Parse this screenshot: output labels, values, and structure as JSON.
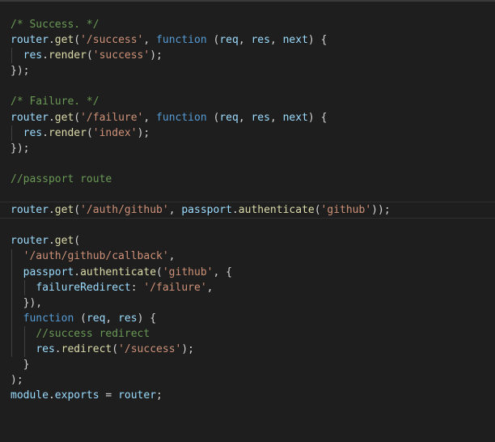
{
  "editor": {
    "theme": {
      "background": "#1e1e1e",
      "comment": "#6a9955",
      "variable": "#9cdcfe",
      "function": "#dcdcaa",
      "string": "#ce9178",
      "keyword": "#569cd6",
      "punctuation": "#d4d4d4"
    },
    "lines": [
      [
        {
          "t": "comment",
          "v": "/* Success. */"
        }
      ],
      [
        {
          "t": "variable",
          "v": "router"
        },
        {
          "t": "punct",
          "v": "."
        },
        {
          "t": "function",
          "v": "get"
        },
        {
          "t": "punct",
          "v": "("
        },
        {
          "t": "string",
          "v": "'/success'"
        },
        {
          "t": "punct",
          "v": ", "
        },
        {
          "t": "keyword",
          "v": "function"
        },
        {
          "t": "punct",
          "v": " ("
        },
        {
          "t": "variable",
          "v": "req"
        },
        {
          "t": "punct",
          "v": ", "
        },
        {
          "t": "variable",
          "v": "res"
        },
        {
          "t": "punct",
          "v": ", "
        },
        {
          "t": "variable",
          "v": "next"
        },
        {
          "t": "punct",
          "v": ") {"
        }
      ],
      [
        {
          "t": "punct",
          "v": "  "
        },
        {
          "t": "variable",
          "v": "res"
        },
        {
          "t": "punct",
          "v": "."
        },
        {
          "t": "function",
          "v": "render"
        },
        {
          "t": "punct",
          "v": "("
        },
        {
          "t": "string",
          "v": "'success'"
        },
        {
          "t": "punct",
          "v": ");"
        }
      ],
      [
        {
          "t": "punct",
          "v": "});"
        }
      ],
      [],
      [
        {
          "t": "comment",
          "v": "/* Failure. */"
        }
      ],
      [
        {
          "t": "variable",
          "v": "router"
        },
        {
          "t": "punct",
          "v": "."
        },
        {
          "t": "function",
          "v": "get"
        },
        {
          "t": "punct",
          "v": "("
        },
        {
          "t": "string",
          "v": "'/failure'"
        },
        {
          "t": "punct",
          "v": ", "
        },
        {
          "t": "keyword",
          "v": "function"
        },
        {
          "t": "punct",
          "v": " ("
        },
        {
          "t": "variable",
          "v": "req"
        },
        {
          "t": "punct",
          "v": ", "
        },
        {
          "t": "variable",
          "v": "res"
        },
        {
          "t": "punct",
          "v": ", "
        },
        {
          "t": "variable",
          "v": "next"
        },
        {
          "t": "punct",
          "v": ") {"
        }
      ],
      [
        {
          "t": "punct",
          "v": "  "
        },
        {
          "t": "variable",
          "v": "res"
        },
        {
          "t": "punct",
          "v": "."
        },
        {
          "t": "function",
          "v": "render"
        },
        {
          "t": "punct",
          "v": "("
        },
        {
          "t": "string",
          "v": "'index'"
        },
        {
          "t": "punct",
          "v": ");"
        }
      ],
      [
        {
          "t": "punct",
          "v": "});"
        }
      ],
      [],
      [
        {
          "t": "comment",
          "v": "//passport route"
        }
      ],
      [],
      [
        {
          "t": "variable",
          "v": "router"
        },
        {
          "t": "punct",
          "v": "."
        },
        {
          "t": "function",
          "v": "get"
        },
        {
          "t": "punct",
          "v": "("
        },
        {
          "t": "string",
          "v": "'/auth/github'"
        },
        {
          "t": "punct",
          "v": ", "
        },
        {
          "t": "variable",
          "v": "passport"
        },
        {
          "t": "punct",
          "v": "."
        },
        {
          "t": "function",
          "v": "authenticate"
        },
        {
          "t": "punct",
          "v": "("
        },
        {
          "t": "string",
          "v": "'github'"
        },
        {
          "t": "punct",
          "v": "));"
        }
      ],
      [],
      [
        {
          "t": "variable",
          "v": "router"
        },
        {
          "t": "punct",
          "v": "."
        },
        {
          "t": "function",
          "v": "get"
        },
        {
          "t": "punct",
          "v": "("
        }
      ],
      [
        {
          "t": "punct",
          "v": "  "
        },
        {
          "t": "string",
          "v": "'/auth/github/callback'"
        },
        {
          "t": "punct",
          "v": ","
        }
      ],
      [
        {
          "t": "punct",
          "v": "  "
        },
        {
          "t": "variable",
          "v": "passport"
        },
        {
          "t": "punct",
          "v": "."
        },
        {
          "t": "function",
          "v": "authenticate"
        },
        {
          "t": "punct",
          "v": "("
        },
        {
          "t": "string",
          "v": "'github'"
        },
        {
          "t": "punct",
          "v": ", {"
        }
      ],
      [
        {
          "t": "punct",
          "v": "    "
        },
        {
          "t": "variable",
          "v": "failureRedirect"
        },
        {
          "t": "punct",
          "v": ": "
        },
        {
          "t": "string",
          "v": "'/failure'"
        },
        {
          "t": "punct",
          "v": ","
        }
      ],
      [
        {
          "t": "punct",
          "v": "  }),"
        }
      ],
      [
        {
          "t": "punct",
          "v": "  "
        },
        {
          "t": "keyword",
          "v": "function"
        },
        {
          "t": "punct",
          "v": " ("
        },
        {
          "t": "variable",
          "v": "req"
        },
        {
          "t": "punct",
          "v": ", "
        },
        {
          "t": "variable",
          "v": "res"
        },
        {
          "t": "punct",
          "v": ") {"
        }
      ],
      [
        {
          "t": "punct",
          "v": "    "
        },
        {
          "t": "comment",
          "v": "//success redirect"
        }
      ],
      [
        {
          "t": "punct",
          "v": "    "
        },
        {
          "t": "variable",
          "v": "res"
        },
        {
          "t": "punct",
          "v": "."
        },
        {
          "t": "function",
          "v": "redirect"
        },
        {
          "t": "punct",
          "v": "("
        },
        {
          "t": "string",
          "v": "'/success'"
        },
        {
          "t": "punct",
          "v": ");"
        }
      ],
      [
        {
          "t": "punct",
          "v": "  }"
        }
      ],
      [
        {
          "t": "punct",
          "v": ");"
        }
      ],
      [
        {
          "t": "variable",
          "v": "module"
        },
        {
          "t": "punct",
          "v": "."
        },
        {
          "t": "variable",
          "v": "exports"
        },
        {
          "t": "punct",
          "v": " = "
        },
        {
          "t": "variable",
          "v": "router"
        },
        {
          "t": "punct",
          "v": ";"
        }
      ]
    ]
  }
}
